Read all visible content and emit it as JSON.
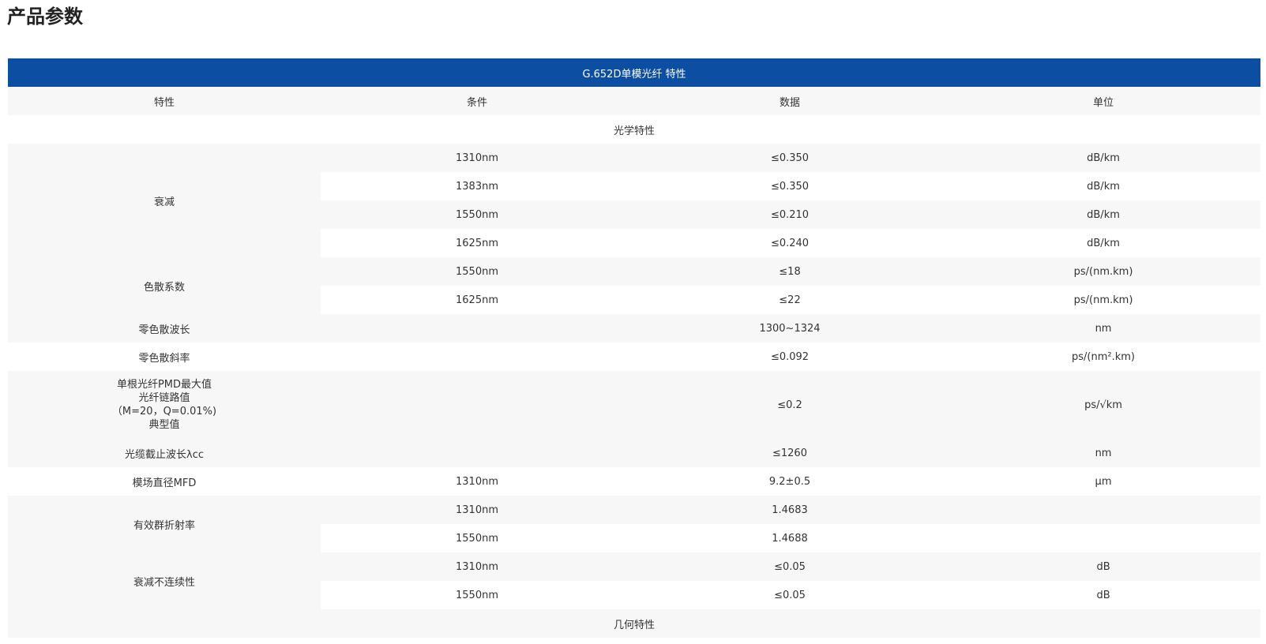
{
  "page": {
    "title": "产品参数"
  },
  "table": {
    "caption": "G.652D单模光纤 特性",
    "headers": [
      "特性",
      "条件",
      "数据",
      "单位"
    ],
    "sections": {
      "optical": "光学特性",
      "geometric": "几何特性"
    },
    "rows": {
      "attenuation": {
        "label": "衰减",
        "items": [
          {
            "cond": "1310nm",
            "value": "≤0.350",
            "unit": "dB/km"
          },
          {
            "cond": "1383nm",
            "value": "≤0.350",
            "unit": "dB/km"
          },
          {
            "cond": "1550nm",
            "value": "≤0.210",
            "unit": "dB/km"
          },
          {
            "cond": "1625nm",
            "value": "≤0.240",
            "unit": "dB/km"
          }
        ]
      },
      "dispersion": {
        "label": "色散系数",
        "items": [
          {
            "cond": "1550nm",
            "value": "≤18",
            "unit": "ps/(nm.km)"
          },
          {
            "cond": "1625nm",
            "value": "≤22",
            "unit": "ps/(nm.km)"
          }
        ]
      },
      "zero_wavelength": {
        "label": "零色散波长",
        "cond": "",
        "value": "1300~1324",
        "unit": "nm"
      },
      "zero_slope": {
        "label": "零色散斜率",
        "cond": "",
        "value": "≤0.092",
        "unit": "ps/(nm².km)"
      },
      "pmd": {
        "label_lines": [
          "单根光纤PMD最大值",
          "光纤链路值",
          "（M=20，Q=0.01%)",
          "典型值"
        ],
        "cond": "",
        "value": "≤0.2",
        "unit": "ps/√km"
      },
      "cutoff": {
        "label": "光缆截止波长λcc",
        "cond": "",
        "value": "≤1260",
        "unit": "nm"
      },
      "mfd": {
        "label": "模场直径MFD",
        "cond": "1310nm",
        "value": "9.2±0.5",
        "unit": "μm"
      },
      "group_index": {
        "label": "有效群折射率",
        "items": [
          {
            "cond": "1310nm",
            "value": "1.4683",
            "unit": ""
          },
          {
            "cond": "1550nm",
            "value": "1.4688",
            "unit": ""
          }
        ]
      },
      "discontinuity": {
        "label": "衰减不连续性",
        "items": [
          {
            "cond": "1310nm",
            "value": "≤0.05",
            "unit": "dB"
          },
          {
            "cond": "1550nm",
            "value": "≤0.05",
            "unit": "dB"
          }
        ]
      }
    }
  },
  "colors": {
    "header_bg": "#0b4ea2",
    "stripe": "#f7f7f7",
    "text": "#333333"
  }
}
